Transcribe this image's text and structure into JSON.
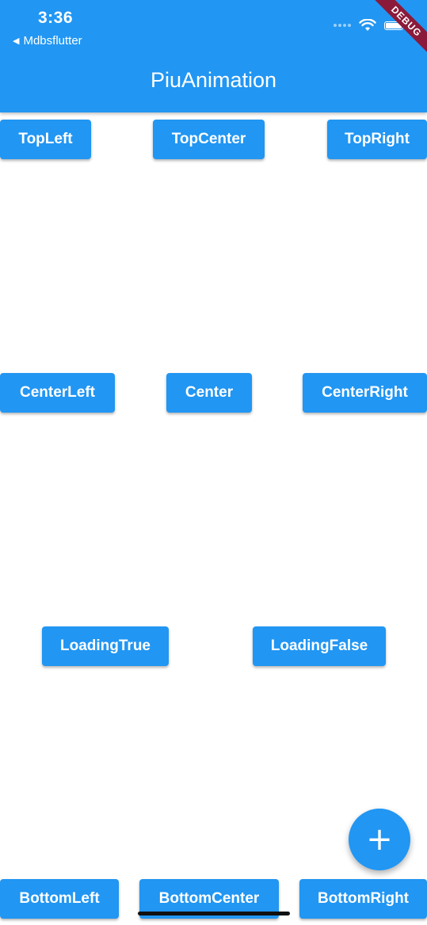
{
  "status_bar": {
    "time": "3:36",
    "back_label": "Mdbsflutter",
    "debug_banner": "DEBUG"
  },
  "app_bar": {
    "title": "PiuAnimation",
    "color": "#2196F3"
  },
  "buttons": {
    "top_left": "TopLeft",
    "top_center": "TopCenter",
    "top_right": "TopRight",
    "center_left": "CenterLeft",
    "center": "Center",
    "center_right": "CenterRight",
    "loading_true": "LoadingTrue",
    "loading_false": "LoadingFalse",
    "bottom_left": "BottomLeft",
    "bottom_center": "BottomCenter",
    "bottom_right": "BottomRight"
  },
  "fab": {
    "icon": "plus-icon",
    "symbol": "+"
  }
}
